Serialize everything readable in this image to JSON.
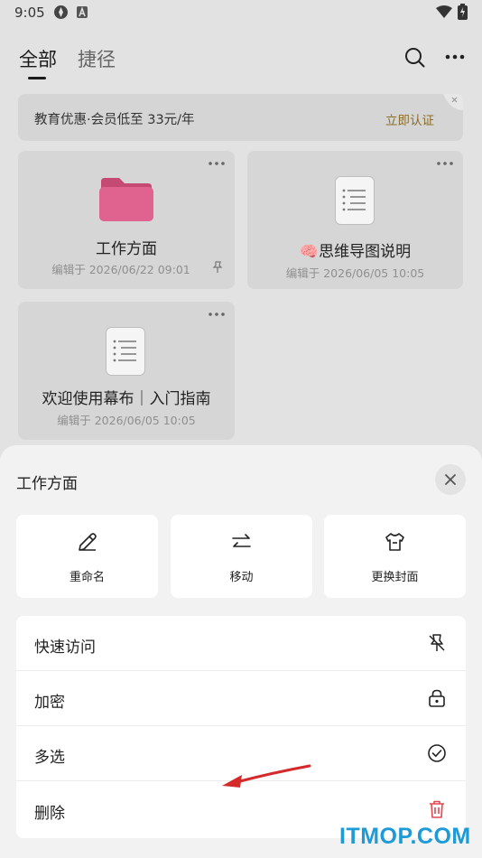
{
  "status_bar": {
    "time": "9:05"
  },
  "header": {
    "tabs": [
      "全部",
      "捷径"
    ]
  },
  "banner": {
    "text": "教育优惠·会员低至 33元/年",
    "action": "立即认证"
  },
  "cards": [
    {
      "title": "工作方面",
      "date": "编辑于 2026/06/22 09:01",
      "type": "folder",
      "folder_color": "#e0628f"
    },
    {
      "title": "🧠思维导图说明",
      "date": "编辑于 2026/06/05 10:05",
      "type": "document"
    },
    {
      "title": "欢迎使用幕布｜入门指南",
      "date": "编辑于 2026/06/05 10:05",
      "type": "document"
    }
  ],
  "sheet": {
    "title": "工作方面",
    "actions": [
      {
        "label": "重命名",
        "icon": "pencil-icon"
      },
      {
        "label": "移动",
        "icon": "swap-arrows-icon"
      },
      {
        "label": "更换封面",
        "icon": "shirt-icon"
      }
    ],
    "menu": [
      {
        "label": "快速访问",
        "icon": "pin-off-icon"
      },
      {
        "label": "加密",
        "icon": "lock-icon"
      },
      {
        "label": "多选",
        "icon": "check-circle-icon"
      },
      {
        "label": "删除",
        "icon": "trash-icon",
        "color": "#e0484e"
      }
    ]
  },
  "watermark": "ITMOP.COM",
  "colors": {
    "accent_link": "#8a6d2a",
    "delete": "#e0484e",
    "arrow": "#d42a2a"
  }
}
